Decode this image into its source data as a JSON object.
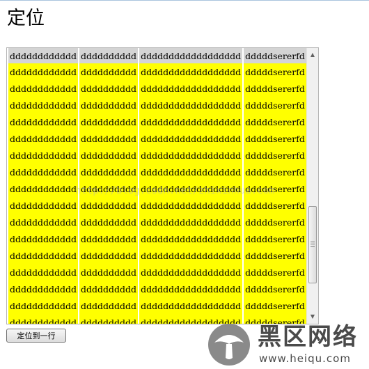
{
  "page": {
    "title": "定位"
  },
  "grid": {
    "header": [
      "dddddddddddd",
      "dddddddddd",
      "dddddddddddddddddd",
      "dddddsererfd"
    ],
    "row": [
      "dddddddddddd",
      "dddddddddd",
      "dddddddddddddddddd",
      "dddddsererfd"
    ],
    "visible_rows": 17
  },
  "scrollbar": {
    "up_arrow": "▲",
    "down_arrow": "▼",
    "position": 0.62
  },
  "button": {
    "locate_label": "定位到一行"
  },
  "watermark": {
    "text": "http://blog.csdn.net/zhixinhua.com"
  },
  "logo": {
    "name": "黑区网络",
    "url": "www.heiqu.com"
  },
  "colors": {
    "cell": "#ffff00",
    "header_cell": "#d4d4d4"
  }
}
